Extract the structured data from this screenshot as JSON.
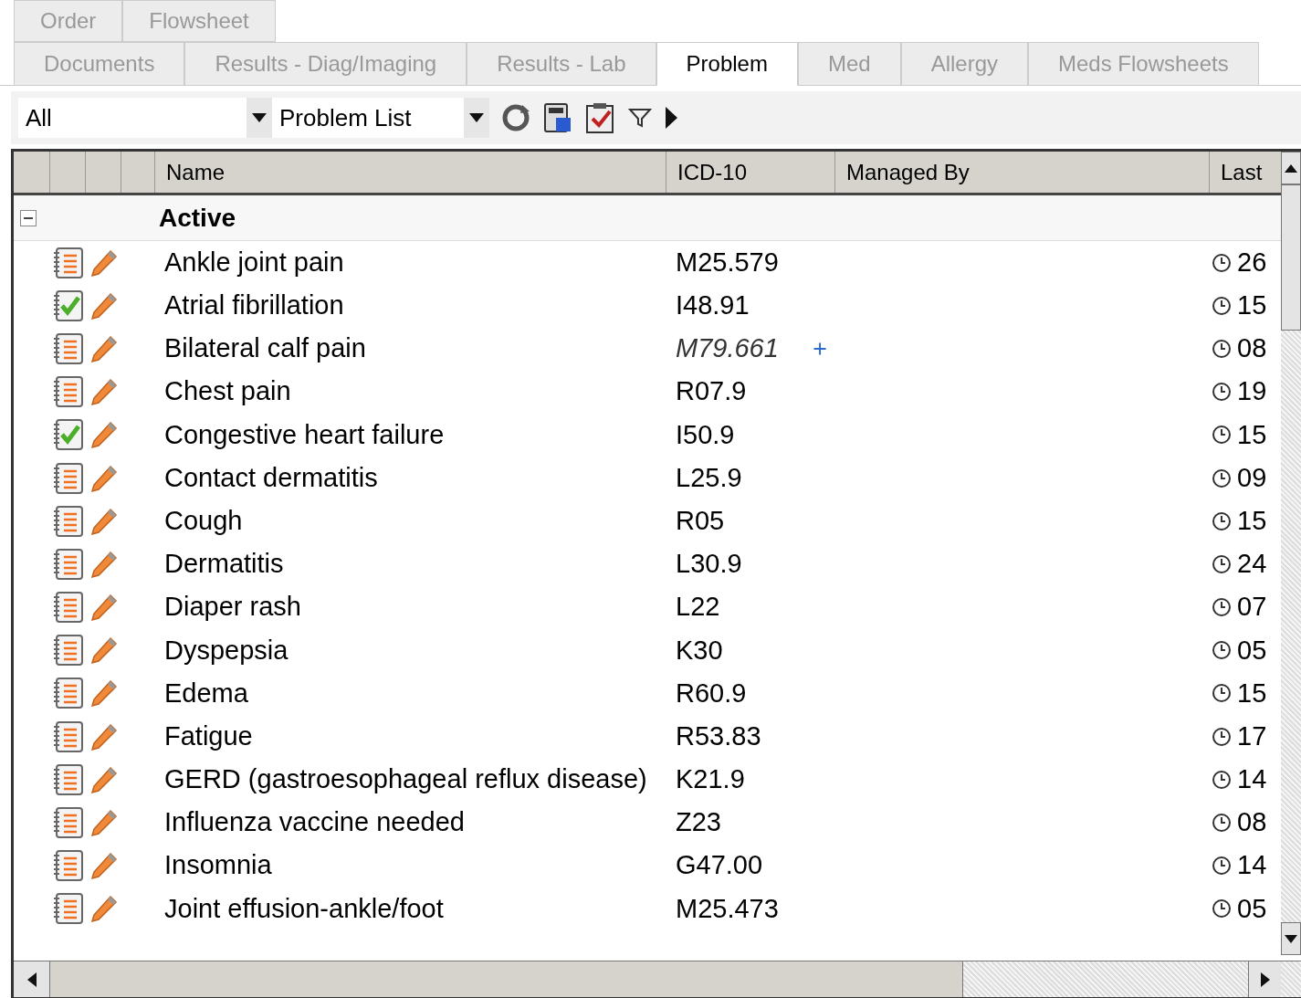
{
  "tab_rows": [
    [
      {
        "label": "Order",
        "selected": false
      },
      {
        "label": "Flowsheet",
        "selected": false
      }
    ],
    [
      {
        "label": "Documents",
        "selected": false
      },
      {
        "label": "Results - Diag/Imaging",
        "selected": false
      },
      {
        "label": "Results - Lab",
        "selected": false
      },
      {
        "label": "Problem",
        "selected": true
      },
      {
        "label": "Med",
        "selected": false
      },
      {
        "label": "Allergy",
        "selected": false
      },
      {
        "label": "Meds Flowsheets",
        "selected": false
      }
    ]
  ],
  "toolbar": {
    "filter_select": "All",
    "view_select": "Problem List"
  },
  "table": {
    "columns": [
      "Name",
      "ICD-10",
      "Managed By",
      "Last"
    ],
    "group": {
      "label": "Active",
      "expanded": true
    },
    "rows": [
      {
        "name": "Ankle joint pain",
        "icd": "M25.579",
        "reviewed": false,
        "suggested": false,
        "last": "26"
      },
      {
        "name": "Atrial fibrillation",
        "icd": "I48.91",
        "reviewed": true,
        "suggested": false,
        "last": "15"
      },
      {
        "name": "Bilateral calf pain",
        "icd": "M79.661",
        "reviewed": false,
        "suggested": true,
        "last": "08"
      },
      {
        "name": "Chest pain",
        "icd": "R07.9",
        "reviewed": false,
        "suggested": false,
        "last": "19"
      },
      {
        "name": "Congestive heart failure",
        "icd": "I50.9",
        "reviewed": true,
        "suggested": false,
        "last": "15"
      },
      {
        "name": "Contact dermatitis",
        "icd": "L25.9",
        "reviewed": false,
        "suggested": false,
        "last": "09"
      },
      {
        "name": "Cough",
        "icd": "R05",
        "reviewed": false,
        "suggested": false,
        "last": "15"
      },
      {
        "name": "Dermatitis",
        "icd": "L30.9",
        "reviewed": false,
        "suggested": false,
        "last": "24"
      },
      {
        "name": "Diaper rash",
        "icd": "L22",
        "reviewed": false,
        "suggested": false,
        "last": "07"
      },
      {
        "name": "Dyspepsia",
        "icd": "K30",
        "reviewed": false,
        "suggested": false,
        "last": "05"
      },
      {
        "name": "Edema",
        "icd": "R60.9",
        "reviewed": false,
        "suggested": false,
        "last": "15"
      },
      {
        "name": "Fatigue",
        "icd": "R53.83",
        "reviewed": false,
        "suggested": false,
        "last": "17"
      },
      {
        "name": "GERD (gastroesophageal reflux disease)",
        "icd": "K21.9",
        "reviewed": false,
        "suggested": false,
        "last": "14"
      },
      {
        "name": "Influenza vaccine needed",
        "icd": "Z23",
        "reviewed": false,
        "suggested": false,
        "last": "08"
      },
      {
        "name": "Insomnia",
        "icd": "G47.00",
        "reviewed": false,
        "suggested": false,
        "last": "14"
      },
      {
        "name": "Joint effusion-ankle/foot",
        "icd": "M25.473",
        "reviewed": false,
        "suggested": false,
        "last": "05"
      }
    ]
  }
}
